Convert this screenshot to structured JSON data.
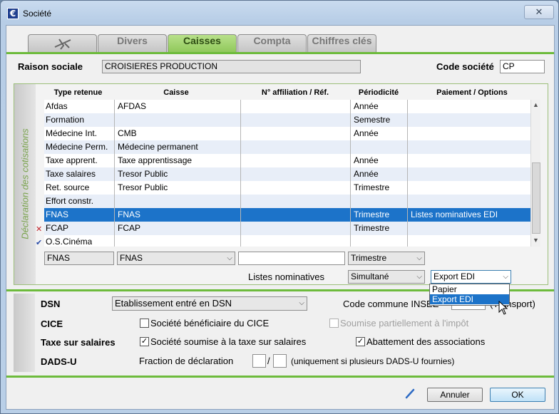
{
  "window": {
    "title": "Société",
    "close": "✕"
  },
  "tabs": [
    {
      "label": "",
      "icon": "plane-icon"
    },
    {
      "label": "Divers"
    },
    {
      "label": "Caisses"
    },
    {
      "label": "Compta"
    },
    {
      "label": "Chiffres clés"
    }
  ],
  "header": {
    "raison_label": "Raison sociale",
    "raison_value": "CROISIERES PRODUCTION",
    "code_label": "Code société",
    "code_value": "CP"
  },
  "declaration": {
    "side_label": "Déclaration des cotisations",
    "columns": [
      "Type retenue",
      "Caisse",
      "N° affiliation / Réf.",
      "Périodicité",
      "Paiement / Options"
    ],
    "rows": [
      {
        "type": "Afdas",
        "caisse": "AFDAS",
        "ref": "",
        "periodicite": "Année",
        "paiement": ""
      },
      {
        "type": "Formation",
        "caisse": "",
        "ref": "",
        "periodicite": "Semestre",
        "paiement": ""
      },
      {
        "type": "Médecine Int.",
        "caisse": "CMB",
        "ref": "",
        "periodicite": "Année",
        "paiement": ""
      },
      {
        "type": "Médecine Perm.",
        "caisse": "Médecine permanent",
        "ref": "",
        "periodicite": "",
        "paiement": ""
      },
      {
        "type": "Taxe apprent.",
        "caisse": "Taxe apprentissage",
        "ref": "",
        "periodicite": "Année",
        "paiement": ""
      },
      {
        "type": "Taxe salaires",
        "caisse": "Tresor Public",
        "ref": "",
        "periodicite": "Année",
        "paiement": ""
      },
      {
        "type": "Ret. source",
        "caisse": "Tresor Public",
        "ref": "",
        "periodicite": "Trimestre",
        "paiement": ""
      },
      {
        "type": "Effort constr.",
        "caisse": "",
        "ref": "",
        "periodicite": "",
        "paiement": ""
      },
      {
        "type": "FNAS",
        "caisse": "FNAS",
        "ref": "",
        "periodicite": "Trimestre",
        "paiement": "Listes nominatives EDI"
      },
      {
        "type": "FCAP",
        "caisse": "FCAP",
        "ref": "",
        "periodicite": "Trimestre",
        "paiement": ""
      },
      {
        "type": "O.S.Cinéma",
        "caisse": "",
        "ref": "",
        "periodicite": "",
        "paiement": ""
      }
    ],
    "row_markers": {
      "fcap": "✕",
      "oscinema": "✔"
    },
    "editor": {
      "type": "FNAS",
      "caisse": "FNAS",
      "ref": "",
      "periodicite": "Trimestre",
      "listes_label": "Listes nominatives",
      "listes_mode": "Simultané",
      "export_value": "Export EDI"
    },
    "dropdown_options": [
      "Papier",
      "Export EDI"
    ]
  },
  "dsn": {
    "dsn_label": "DSN",
    "dsn_value": "Etablissement entré en DSN",
    "commune_label": "Code commune INSEE",
    "commune_suffix": "(Transport)",
    "cice_label": "CICE",
    "cice_check": "Société bénéficiaire du CICE",
    "cice_partial": "Soumise partiellement à l'impôt",
    "taxe_label": "Taxe sur salaires",
    "taxe_check": "Société soumise à la taxe sur salaires",
    "abattement_check": "Abattement des associations",
    "dadsu_label": "DADS-U",
    "fraction_label": "Fraction de déclaration",
    "fraction_sep": "/",
    "fraction_note": "(uniquement si plusieurs DADS-U fournies)"
  },
  "footer": {
    "cancel": "Annuler",
    "ok": "OK"
  },
  "colors": {
    "accent_green": "#6dbb3c",
    "selection_blue": "#1c73c9"
  }
}
